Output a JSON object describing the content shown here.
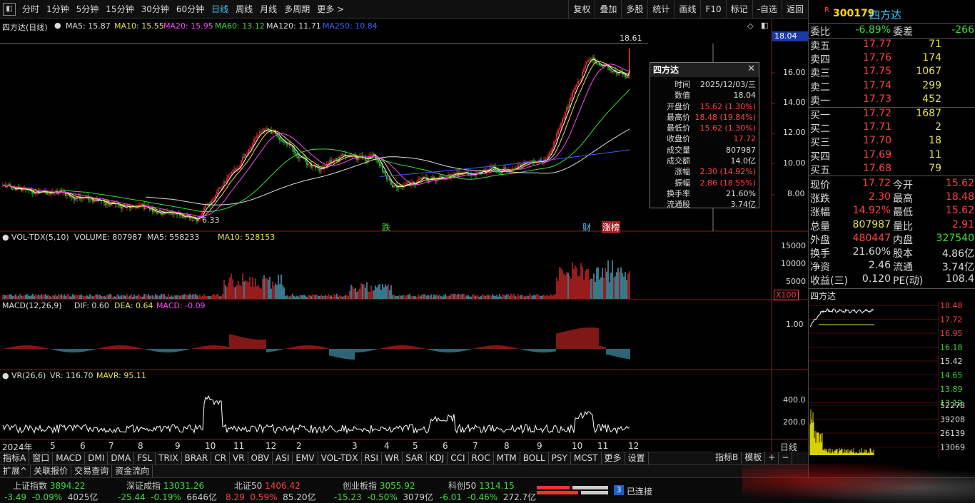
{
  "toolbar": {
    "periods": [
      "分时",
      "1分钟",
      "5分钟",
      "15分钟",
      "30分钟",
      "60分钟",
      "日线",
      "周线",
      "月线",
      "多周期",
      "更多 >"
    ],
    "active_period": "日线",
    "tools": [
      "复权",
      "叠加",
      "多股",
      "统计",
      "画线",
      "F10",
      "标记",
      "-自选",
      "返回"
    ]
  },
  "main_pane": {
    "title": "四方达(日线)",
    "ma": [
      "MA5: 15.87",
      "MA10: 15.55",
      "MA20: 15.95",
      "MA60: 13.12",
      "MA120: 11.71",
      "MA250: 10.84"
    ],
    "price_ticks": [
      "16.00",
      "14.00",
      "12.00",
      "10.00",
      "8.00"
    ],
    "current_price_tag": "18.04",
    "high_label": "18.61",
    "low_label": "6.33",
    "markers": [
      "跌",
      "财",
      "涨榜"
    ]
  },
  "vol_pane": {
    "label": "VOL-TDX(5,10)",
    "stats": [
      "VOLUME: 807987",
      "MA5: 558233",
      "MA10: 528153"
    ],
    "ticks": [
      "15000",
      "10000",
      "5000"
    ],
    "unit": "X100"
  },
  "macd_pane": {
    "label": "MACD(12,26,9)",
    "stats": [
      "DIF: 0.60",
      "DEA: 0.64",
      "MACD: -0.09"
    ],
    "ticks": [
      "1.00"
    ]
  },
  "vr_pane": {
    "label": "VR(26,6)",
    "stats": [
      "VR: 116.70",
      "MAVR: 95.11"
    ],
    "ticks": [
      "400.0",
      "200.0"
    ]
  },
  "x_axis": {
    "months": [
      "2024年",
      "5",
      "6",
      "7",
      "8",
      "9",
      "10",
      "11",
      "12",
      "2",
      "3",
      "4",
      "5",
      "6",
      "7",
      "8",
      "9",
      "10",
      "11",
      "12"
    ],
    "period_label": "日线"
  },
  "popup": {
    "title": "四方达",
    "rows": [
      {
        "k": "时间",
        "v": "2025/12/03/三",
        "c": ""
      },
      {
        "k": "数值",
        "v": "18.04",
        "c": ""
      },
      {
        "k": "开盘价",
        "v": "15.62 (1.30%)",
        "c": "red"
      },
      {
        "k": "最高价",
        "v": "18.48 (19.84%)",
        "c": "red"
      },
      {
        "k": "最低价",
        "v": "15.62 (1.30%)",
        "c": "red"
      },
      {
        "k": "收盘价",
        "v": "17.72",
        "c": "red"
      },
      {
        "k": "成交量",
        "v": "807987",
        "c": ""
      },
      {
        "k": "成交额",
        "v": "14.0亿",
        "c": ""
      },
      {
        "k": "涨幅",
        "v": "2.30 (14.92%)",
        "c": "red"
      },
      {
        "k": "振幅",
        "v": "2.86 (18.55%)",
        "c": "red"
      },
      {
        "k": "换手率",
        "v": "21.60%",
        "c": ""
      },
      {
        "k": "流通股",
        "v": "3.74亿",
        "c": ""
      }
    ]
  },
  "indicator_tabs": [
    "指标A",
    "窗口",
    "MACD",
    "DMI",
    "DMA",
    "FSL",
    "TRIX",
    "BRAR",
    "CR",
    "VR",
    "OBV",
    "ASI",
    "EMV",
    "VOL-TDX",
    "RSI",
    "WR",
    "SAR",
    "KDJ",
    "CCI",
    "ROC",
    "MTM",
    "BOLL",
    "PSY",
    "MCST",
    "更多",
    "设置"
  ],
  "right_tabs": [
    "指标B",
    "模板",
    "+",
    "−"
  ],
  "sub_tabs": [
    "扩展^",
    "关联报价",
    "交易查询",
    "资金流向"
  ],
  "quote": {
    "badge": "R",
    "code": "300179",
    "name": "四方达",
    "weibi_label": "委比",
    "weibi": "-6.89%",
    "weicha_label": "委差",
    "weicha": "-266",
    "asks": [
      {
        "label": "卖五",
        "price": "17.77",
        "vol": "71"
      },
      {
        "label": "卖四",
        "price": "17.76",
        "vol": "174"
      },
      {
        "label": "卖三",
        "price": "17.75",
        "vol": "1067"
      },
      {
        "label": "卖二",
        "price": "17.74",
        "vol": "299"
      },
      {
        "label": "卖一",
        "price": "17.73",
        "vol": "452"
      }
    ],
    "bids": [
      {
        "label": "买一",
        "price": "17.72",
        "vol": "1687"
      },
      {
        "label": "买二",
        "price": "17.71",
        "vol": "2"
      },
      {
        "label": "买三",
        "price": "17.70",
        "vol": "18"
      },
      {
        "label": "买四",
        "price": "17.69",
        "vol": "11"
      },
      {
        "label": "买五",
        "price": "17.68",
        "vol": "79"
      }
    ],
    "stats": [
      {
        "l1": "现价",
        "v1": "17.72",
        "c1": "red",
        "l2": "今开",
        "v2": "15.62",
        "c2": "red"
      },
      {
        "l1": "涨跌",
        "v1": "2.30",
        "c1": "red",
        "l2": "最高",
        "v2": "18.48",
        "c2": "red"
      },
      {
        "l1": "涨幅",
        "v1": "14.92%",
        "c1": "red",
        "l2": "最低",
        "v2": "15.62",
        "c2": "red"
      },
      {
        "l1": "总量",
        "v1": "807987",
        "c1": "yellow",
        "l2": "量比",
        "v2": "2.91",
        "c2": "red"
      },
      {
        "l1": "外盘",
        "v1": "480447",
        "c1": "red",
        "l2": "内盘",
        "v2": "327540",
        "c2": "green"
      },
      {
        "l1": "换手",
        "v1": "21.60%",
        "c1": "white",
        "l2": "股本",
        "v2": "4.86亿",
        "c2": "white"
      },
      {
        "l1": "净资",
        "v1": "2.46",
        "c1": "white",
        "l2": "流通",
        "v2": "3.74亿",
        "c2": "white"
      },
      {
        "l1": "收益(三)",
        "v1": "0.120",
        "c1": "white",
        "l2": "PE(动)",
        "v2": "108.4",
        "c2": "white"
      }
    ],
    "mini_title": "四方达",
    "mini_ticks": [
      "18.48",
      "17.72",
      "16.95",
      "16.18",
      "15.42",
      "14.65",
      "13.89",
      "13.12"
    ],
    "vol_ticks": [
      "52278",
      "39208",
      "26139",
      "13069"
    ]
  },
  "status": {
    "indices": [
      {
        "name": "上证指数",
        "val": "3894.22",
        "chg": "-3.49",
        "pct": "-0.09%",
        "amt": "4025亿",
        "c": "green"
      },
      {
        "name": "深证成指",
        "val": "13031.26",
        "chg": "-25.44",
        "pct": "-0.19%",
        "amt": "6646亿",
        "c": "green"
      },
      {
        "name": "北证50",
        "val": "1406.42",
        "chg": "8.29",
        "pct": "0.59%",
        "amt": "85.20亿",
        "c": "red"
      },
      {
        "name": "创业板指",
        "val": "3055.92",
        "chg": "-15.23",
        "pct": "-0.50%",
        "amt": "3079亿",
        "c": "green"
      },
      {
        "name": "科创50",
        "val": "1314.15",
        "chg": "-6.01",
        "pct": "-0.46%",
        "amt": "272.7亿",
        "c": "green"
      }
    ],
    "conn_count": "3",
    "conn_text": "已连接"
  }
}
